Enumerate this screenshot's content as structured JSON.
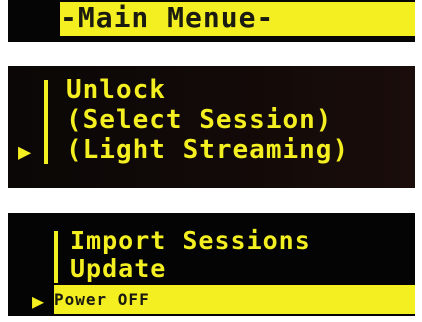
{
  "screens": [
    {
      "title": "-Main Menue-"
    },
    {
      "items": [
        "Unlock",
        "(Select Session)",
        "(Light Streaming)"
      ],
      "selected_index": 2,
      "cursor_icon": "triangle-right-icon"
    },
    {
      "items": [
        "Import Sessions",
        "Update",
        "Power OFF"
      ],
      "selected_index": 2,
      "cursor_icon": "triangle-right-icon"
    }
  ],
  "colors": {
    "text": "#f4ef20",
    "background": "#060606",
    "highlight_text": "#1a1a10"
  }
}
